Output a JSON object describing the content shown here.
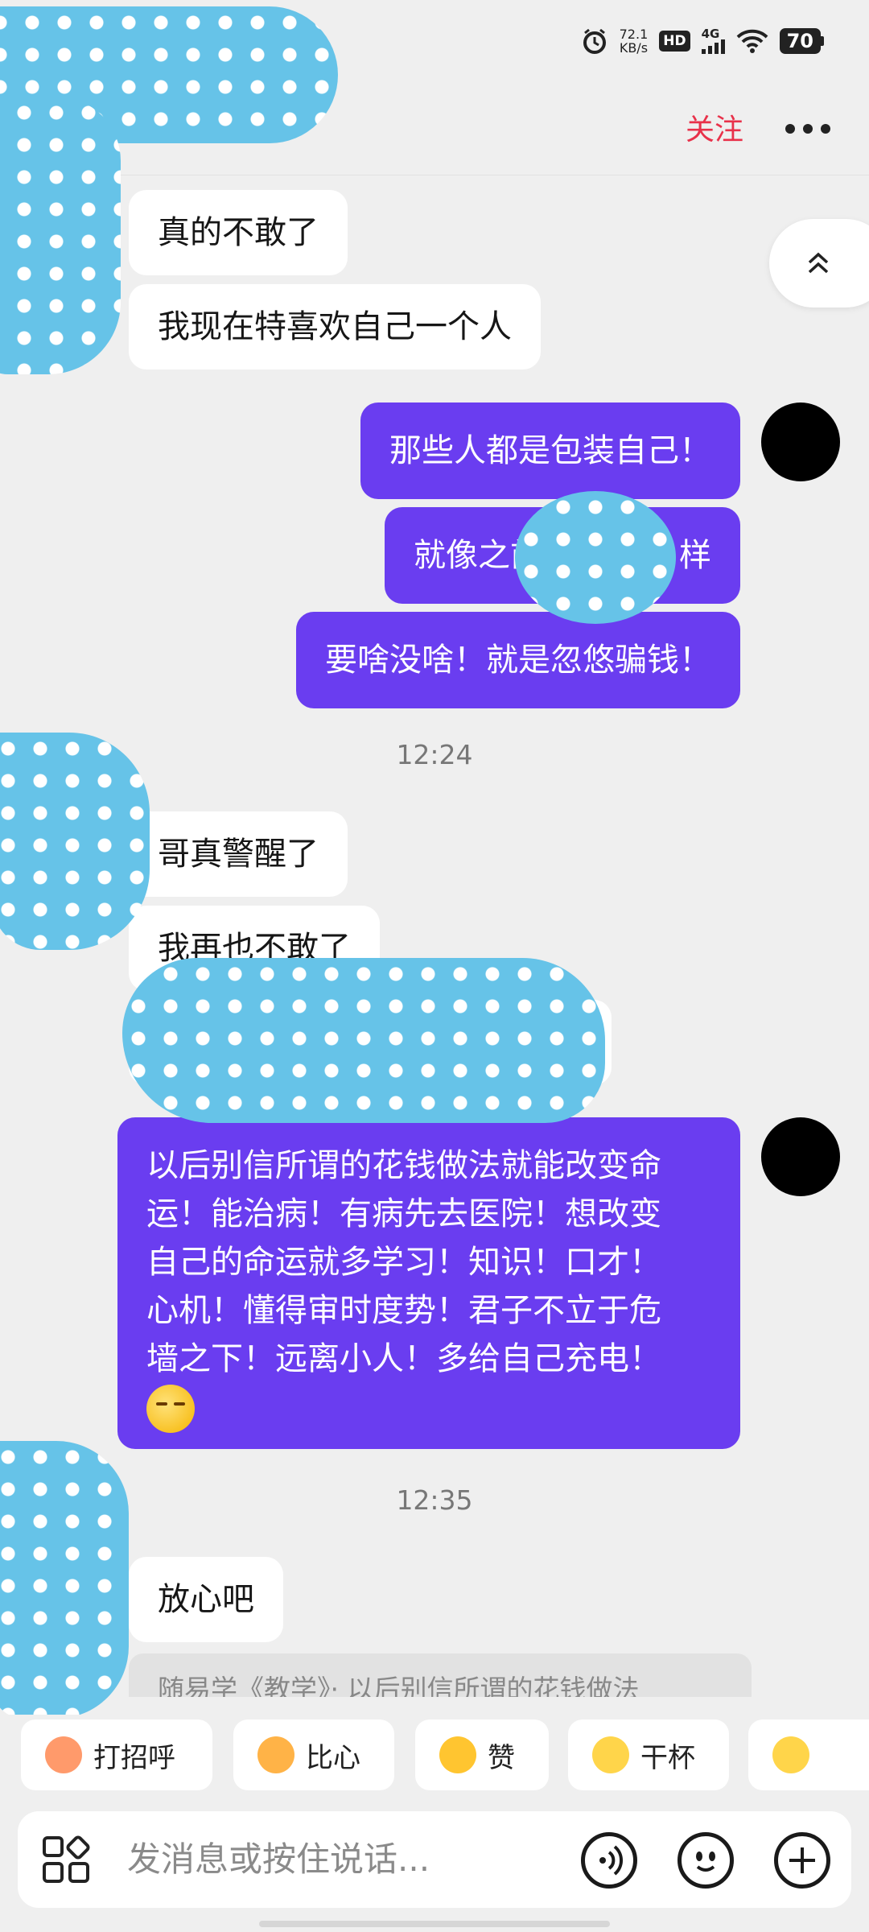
{
  "status_bar": {
    "net_speed_value": "72.1",
    "net_speed_unit": "KB/s",
    "hd_badge": "HD",
    "signal_label": "4G",
    "battery": "70"
  },
  "header": {
    "follow_label": "关注"
  },
  "messages": [
    {
      "text": "真的不敢了"
    },
    {
      "text": "我现在特喜欢自己一个人"
    },
    {
      "text": "那些人都是包装自己！"
    },
    {
      "text_before": "就像之前",
      "text_after": "样"
    },
    {
      "text": "要啥没啥！就是忽悠骗钱！"
    },
    {
      "text": "哥真警醒了"
    },
    {
      "text": "我再也不敢了"
    },
    {
      "text": ""
    },
    {
      "lines": [
        "以后别信所谓的花钱做法就能改变命",
        "运！能治病！有病先去医院！想改变",
        "自己的命运就多学习！知识！口才！",
        "心机！懂得审时度势！君子不立于危",
        "墙之下！远离小人！多给自己充电！"
      ]
    },
    {
      "text": "放心吧"
    }
  ],
  "timestamps": [
    "12:24",
    "12:35"
  ],
  "quoted_preview": "随易学《教学》· 以后别信所谓的花钱做法",
  "quick_replies": [
    {
      "label": "打招呼",
      "icon": "wave-hello-icon",
      "color": "#ff9a6b"
    },
    {
      "label": "比心",
      "icon": "heart-hands-icon",
      "color": "#ffb347"
    },
    {
      "label": "赞",
      "icon": "thumbs-up-icon",
      "color": "#ffc530"
    },
    {
      "label": "干杯",
      "icon": "cheers-icon",
      "color": "#ffd54a"
    },
    {
      "label": "",
      "icon": "laughing-emoji-icon",
      "color": "#ffd54a"
    }
  ],
  "input": {
    "placeholder": "发消息或按住说话..."
  },
  "colors": {
    "accent_follow": "#e8314a",
    "outgoing_bubble": "#6a3df0",
    "incoming_bubble": "#ffffff",
    "background": "#efefef"
  }
}
